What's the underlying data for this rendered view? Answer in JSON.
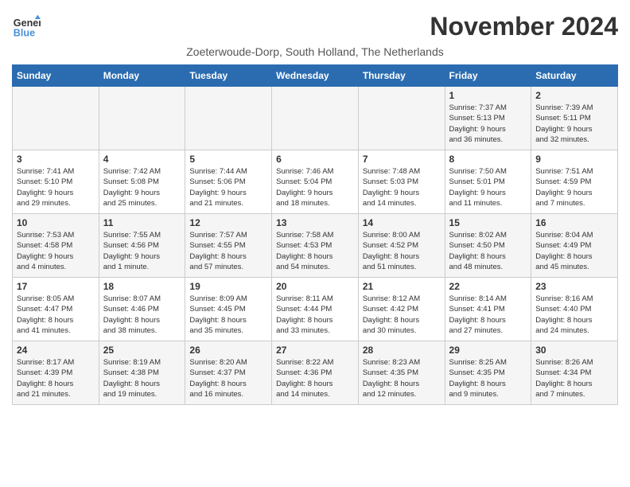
{
  "logo": {
    "line1": "General",
    "line2": "Blue"
  },
  "title": "November 2024",
  "location": "Zoeterwoude-Dorp, South Holland, The Netherlands",
  "days_of_week": [
    "Sunday",
    "Monday",
    "Tuesday",
    "Wednesday",
    "Thursday",
    "Friday",
    "Saturday"
  ],
  "weeks": [
    [
      {
        "day": "",
        "info": ""
      },
      {
        "day": "",
        "info": ""
      },
      {
        "day": "",
        "info": ""
      },
      {
        "day": "",
        "info": ""
      },
      {
        "day": "",
        "info": ""
      },
      {
        "day": "1",
        "info": "Sunrise: 7:37 AM\nSunset: 5:13 PM\nDaylight: 9 hours\nand 36 minutes."
      },
      {
        "day": "2",
        "info": "Sunrise: 7:39 AM\nSunset: 5:11 PM\nDaylight: 9 hours\nand 32 minutes."
      }
    ],
    [
      {
        "day": "3",
        "info": "Sunrise: 7:41 AM\nSunset: 5:10 PM\nDaylight: 9 hours\nand 29 minutes."
      },
      {
        "day": "4",
        "info": "Sunrise: 7:42 AM\nSunset: 5:08 PM\nDaylight: 9 hours\nand 25 minutes."
      },
      {
        "day": "5",
        "info": "Sunrise: 7:44 AM\nSunset: 5:06 PM\nDaylight: 9 hours\nand 21 minutes."
      },
      {
        "day": "6",
        "info": "Sunrise: 7:46 AM\nSunset: 5:04 PM\nDaylight: 9 hours\nand 18 minutes."
      },
      {
        "day": "7",
        "info": "Sunrise: 7:48 AM\nSunset: 5:03 PM\nDaylight: 9 hours\nand 14 minutes."
      },
      {
        "day": "8",
        "info": "Sunrise: 7:50 AM\nSunset: 5:01 PM\nDaylight: 9 hours\nand 11 minutes."
      },
      {
        "day": "9",
        "info": "Sunrise: 7:51 AM\nSunset: 4:59 PM\nDaylight: 9 hours\nand 7 minutes."
      }
    ],
    [
      {
        "day": "10",
        "info": "Sunrise: 7:53 AM\nSunset: 4:58 PM\nDaylight: 9 hours\nand 4 minutes."
      },
      {
        "day": "11",
        "info": "Sunrise: 7:55 AM\nSunset: 4:56 PM\nDaylight: 9 hours\nand 1 minute."
      },
      {
        "day": "12",
        "info": "Sunrise: 7:57 AM\nSunset: 4:55 PM\nDaylight: 8 hours\nand 57 minutes."
      },
      {
        "day": "13",
        "info": "Sunrise: 7:58 AM\nSunset: 4:53 PM\nDaylight: 8 hours\nand 54 minutes."
      },
      {
        "day": "14",
        "info": "Sunrise: 8:00 AM\nSunset: 4:52 PM\nDaylight: 8 hours\nand 51 minutes."
      },
      {
        "day": "15",
        "info": "Sunrise: 8:02 AM\nSunset: 4:50 PM\nDaylight: 8 hours\nand 48 minutes."
      },
      {
        "day": "16",
        "info": "Sunrise: 8:04 AM\nSunset: 4:49 PM\nDaylight: 8 hours\nand 45 minutes."
      }
    ],
    [
      {
        "day": "17",
        "info": "Sunrise: 8:05 AM\nSunset: 4:47 PM\nDaylight: 8 hours\nand 41 minutes."
      },
      {
        "day": "18",
        "info": "Sunrise: 8:07 AM\nSunset: 4:46 PM\nDaylight: 8 hours\nand 38 minutes."
      },
      {
        "day": "19",
        "info": "Sunrise: 8:09 AM\nSunset: 4:45 PM\nDaylight: 8 hours\nand 35 minutes."
      },
      {
        "day": "20",
        "info": "Sunrise: 8:11 AM\nSunset: 4:44 PM\nDaylight: 8 hours\nand 33 minutes."
      },
      {
        "day": "21",
        "info": "Sunrise: 8:12 AM\nSunset: 4:42 PM\nDaylight: 8 hours\nand 30 minutes."
      },
      {
        "day": "22",
        "info": "Sunrise: 8:14 AM\nSunset: 4:41 PM\nDaylight: 8 hours\nand 27 minutes."
      },
      {
        "day": "23",
        "info": "Sunrise: 8:16 AM\nSunset: 4:40 PM\nDaylight: 8 hours\nand 24 minutes."
      }
    ],
    [
      {
        "day": "24",
        "info": "Sunrise: 8:17 AM\nSunset: 4:39 PM\nDaylight: 8 hours\nand 21 minutes."
      },
      {
        "day": "25",
        "info": "Sunrise: 8:19 AM\nSunset: 4:38 PM\nDaylight: 8 hours\nand 19 minutes."
      },
      {
        "day": "26",
        "info": "Sunrise: 8:20 AM\nSunset: 4:37 PM\nDaylight: 8 hours\nand 16 minutes."
      },
      {
        "day": "27",
        "info": "Sunrise: 8:22 AM\nSunset: 4:36 PM\nDaylight: 8 hours\nand 14 minutes."
      },
      {
        "day": "28",
        "info": "Sunrise: 8:23 AM\nSunset: 4:35 PM\nDaylight: 8 hours\nand 12 minutes."
      },
      {
        "day": "29",
        "info": "Sunrise: 8:25 AM\nSunset: 4:35 PM\nDaylight: 8 hours\nand 9 minutes."
      },
      {
        "day": "30",
        "info": "Sunrise: 8:26 AM\nSunset: 4:34 PM\nDaylight: 8 hours\nand 7 minutes."
      }
    ]
  ]
}
